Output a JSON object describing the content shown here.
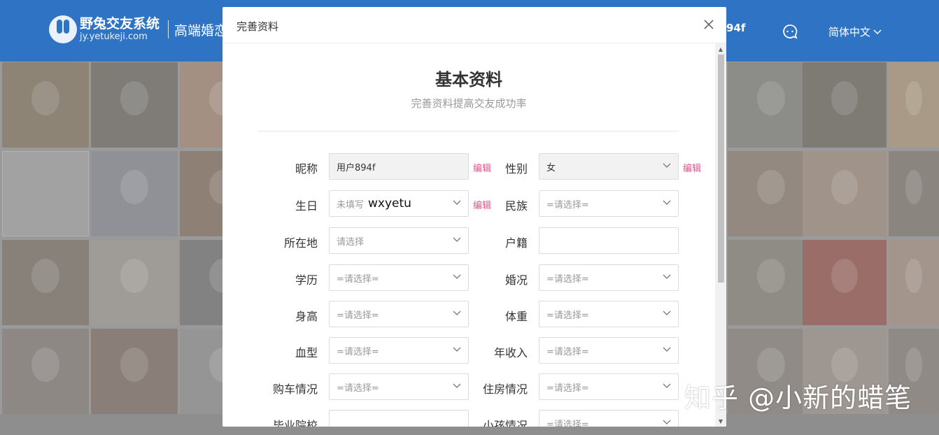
{
  "site": {
    "logo_name": "野兔交友系统",
    "logo_url": "jy.yetukeji.com",
    "slogan": "高端婚恋",
    "user_suffix": "94f",
    "language": "简体中文"
  },
  "modal": {
    "title": "完善资料",
    "section_title": "基本资料",
    "section_subtitle": "完善资料提高交友成功率",
    "edit_label": "编辑",
    "fields": {
      "nickname": {
        "label": "昵称",
        "value": "用户894f"
      },
      "gender": {
        "label": "性别",
        "value": "女"
      },
      "birthday": {
        "label": "生日",
        "placeholder": "未填写",
        "overlay": "wxyetu"
      },
      "ethnicity": {
        "label": "民族",
        "placeholder": "=请选择="
      },
      "location": {
        "label": "所在地",
        "placeholder": "请选择"
      },
      "hukou": {
        "label": "户籍",
        "value": ""
      },
      "education": {
        "label": "学历",
        "placeholder": "=请选择="
      },
      "marital": {
        "label": "婚况",
        "placeholder": "=请选择="
      },
      "height": {
        "label": "身高",
        "placeholder": "=请选择="
      },
      "weight": {
        "label": "体重",
        "placeholder": "=请选择="
      },
      "blood": {
        "label": "血型",
        "placeholder": "=请选择="
      },
      "income": {
        "label": "年收入",
        "placeholder": "=请选择="
      },
      "car": {
        "label": "购车情况",
        "placeholder": "=请选择="
      },
      "house": {
        "label": "住房情况",
        "placeholder": "=请选择="
      },
      "school": {
        "label": "毕业院校",
        "value": ""
      },
      "children": {
        "label": "小孩情况",
        "placeholder": "=请选择="
      }
    }
  },
  "watermark": "知乎 @小新的蜡笔"
}
